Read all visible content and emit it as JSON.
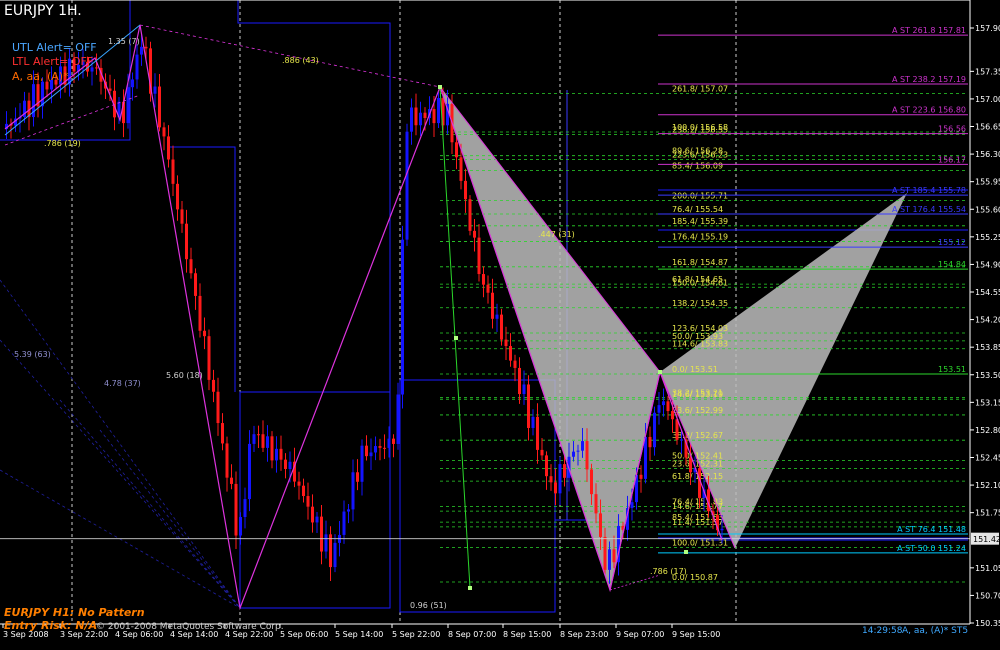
{
  "window": {
    "symbol_title": "EURJPY 1H.",
    "utl_alert": "UTL Alert= OFF",
    "ltl_alert": "LTL Alert= OFF",
    "pattern_label": "A, aa, (A)*",
    "status_line1": "EURJPY H1: No Pattern",
    "status_line2": "Entry Risk: N/A",
    "copyright": "© 2001-2008 MetaQuotes Software Corp.",
    "clock_text": "14:29:58",
    "pattern_footer": "A, aa, (A)* ST5",
    "current_price_label": "151.42"
  },
  "colors": {
    "bull": "#1414ff",
    "bear": "#ff1a1a",
    "fib": "#2bd62b",
    "fib_label": "#e6e64c",
    "st": "#cc33cc",
    "envelope": "#1a1aff",
    "pattern": "#bdbdbd",
    "zigzag": "#dd33dd"
  },
  "price_axis": {
    "labels": [
      "157.90",
      "157.35",
      "157.00",
      "156.65",
      "156.30",
      "155.95",
      "155.60",
      "155.25",
      "154.90",
      "154.55",
      "154.20",
      "153.85",
      "153.50",
      "153.15",
      "152.80",
      "152.45",
      "152.10",
      "151.75",
      "151.42",
      "151.05",
      "150.70",
      "150.35"
    ],
    "min": 150.35,
    "max": 157.9
  },
  "time_axis": {
    "labels": [
      "3 Sep 2008",
      "3 Sep 22:00",
      "4 Sep 06:00",
      "4 Sep 14:00",
      "4 Sep 22:00",
      "5 Sep 06:00",
      "5 Sep 14:00",
      "5 Sep 22:00",
      "8 Sep 07:00",
      "8 Sep 15:00",
      "8 Sep 23:00",
      "9 Sep 07:00",
      "9 Sep 15:00"
    ]
  },
  "fib_levels": [
    {
      "label": "261.8/ 157.07",
      "price": 157.07
    },
    {
      "label": "100.0/ 156.58",
      "price": 156.58
    },
    {
      "label": "238.2/ 156.55",
      "price": 156.55
    },
    {
      "label": "89.6/ 156.28",
      "price": 156.28
    },
    {
      "label": "223.6/ 156.23",
      "price": 156.23
    },
    {
      "label": "85.4/ 156.09",
      "price": 156.09
    },
    {
      "label": "200.0/ 155.71",
      "price": 155.71
    },
    {
      "label": "76.4/ 155.54",
      "price": 155.54
    },
    {
      "label": "185.4/ 155.39",
      "price": 155.39
    },
    {
      "label": "176.4/ 155.19",
      "price": 155.19
    },
    {
      "label": "161.8/ 154.87",
      "price": 154.87
    },
    {
      "label": "61.8/ 154.65",
      "price": 154.65
    },
    {
      "label": "150.0/ 154.61",
      "price": 154.61
    },
    {
      "label": "138.2/ 154.35",
      "price": 154.35
    },
    {
      "label": "123.6/ 154.03",
      "price": 154.03
    },
    {
      "label": "50.0/ 153.93",
      "price": 153.93
    },
    {
      "label": "114.6/ 153.83",
      "price": 153.83
    },
    {
      "label": "0.0/ 153.51",
      "price": 153.51
    },
    {
      "label": "38.2/ 153.21",
      "price": 153.21
    },
    {
      "label": "14.6/ 153.19",
      "price": 153.19
    },
    {
      "label": "23.6/ 152.99",
      "price": 152.99
    },
    {
      "label": "38.2/ 152.67",
      "price": 152.67
    },
    {
      "label": "50.0/ 152.41",
      "price": 152.41
    },
    {
      "label": "23.6/ 152.31",
      "price": 152.31
    },
    {
      "label": "61.8/ 152.15",
      "price": 152.15
    },
    {
      "label": "76.4/ 151.83",
      "price": 151.83
    },
    {
      "label": "14.6/ 151.77",
      "price": 151.77
    },
    {
      "label": "85.4/ 151.63",
      "price": 151.63
    },
    {
      "label": "11.4/ 151.57",
      "price": 151.57
    },
    {
      "label": "100.0/ 151.31",
      "price": 151.31
    },
    {
      "label": "0.0/ 150.87",
      "price": 150.87
    }
  ],
  "st_levels": [
    {
      "label": "A ST 261.8 157.81",
      "price": 157.81
    },
    {
      "label": "A ST 238.2 157.19",
      "price": 157.19
    },
    {
      "label": "A ST 223.6 156.80",
      "price": 156.8
    },
    {
      "label": "156.56",
      "price": 156.56
    },
    {
      "label": "156.17",
      "price": 156.17
    },
    {
      "label": "A ST 185.4 155.78",
      "price": 155.78
    },
    {
      "label": "A ST 176.4 155.54",
      "price": 155.54
    },
    {
      "label": "155.12",
      "price": 155.12
    },
    {
      "label": "154.84",
      "price": 154.84
    },
    {
      "label": "153.51",
      "price": 153.51
    },
    {
      "label": "A ST 76.4 151.48",
      "price": 151.48
    },
    {
      "label": "A ST 50.0 151.24",
      "price": 151.24
    }
  ],
  "annotations": [
    {
      "text": "1.35 (7)"
    },
    {
      "text": ".886 (43)"
    },
    {
      "text": ".786 (19)"
    },
    {
      "text": ".447 (31)"
    },
    {
      "text": "5.39 (63)"
    },
    {
      "text": "4.78 (37)"
    },
    {
      "text": "5.60 (18)"
    },
    {
      "text": "0.96 (51)"
    },
    {
      "text": ".786 (17)"
    }
  ]
}
